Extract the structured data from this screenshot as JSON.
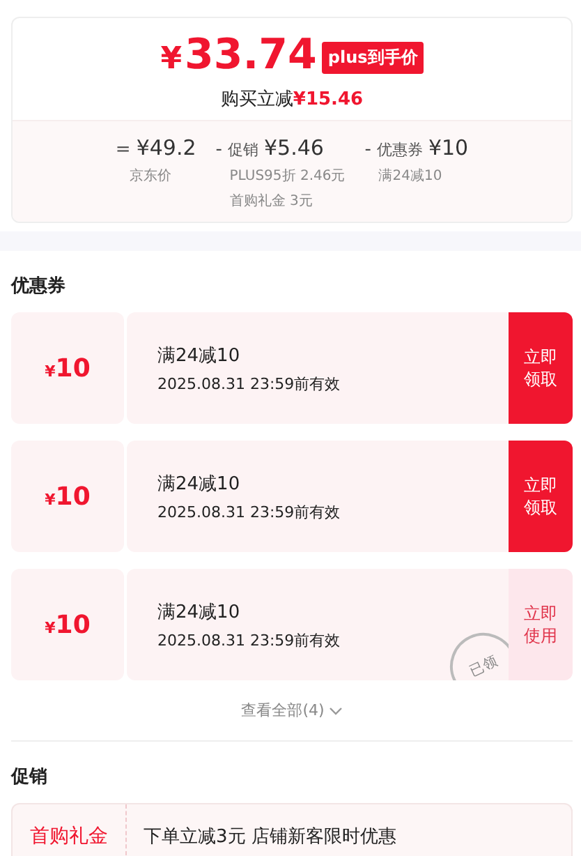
{
  "price_card": {
    "currency": "¥",
    "price": "33.74",
    "price_tag": "plus到手价",
    "saving_label": "购买立减",
    "saving": "¥15.46",
    "breakdown": [
      {
        "operator": "=",
        "amount": "¥49.2",
        "notes": [
          "京东价"
        ]
      },
      {
        "operator": "-",
        "label": "促销",
        "amount": "¥5.46",
        "notes": [
          "PLUS95折 2.46元",
          "首购礼金 3元"
        ]
      },
      {
        "operator": "-",
        "label": "优惠券",
        "amount": "¥10",
        "notes": [
          "满24减10"
        ]
      }
    ]
  },
  "coupons_section": {
    "title": "优惠券",
    "coupons": [
      {
        "currency": "¥",
        "amount": "10",
        "condition": "满24减10",
        "validity": "2025.08.31 23:59前有效",
        "action": "立即领取",
        "claimed": false
      },
      {
        "currency": "¥",
        "amount": "10",
        "condition": "满24减10",
        "validity": "2025.08.31 23:59前有效",
        "action": "立即领取",
        "claimed": false
      },
      {
        "currency": "¥",
        "amount": "10",
        "condition": "满24减10",
        "validity": "2025.08.31 23:59前有效",
        "action": "立即使用",
        "claimed": true,
        "stamp": "已领"
      }
    ],
    "view_all": "查看全部(4)"
  },
  "promotions_section": {
    "title": "促销",
    "items": [
      {
        "tag": "首购礼金",
        "text": "下单立减3元 店铺新客限时优惠"
      }
    ]
  }
}
